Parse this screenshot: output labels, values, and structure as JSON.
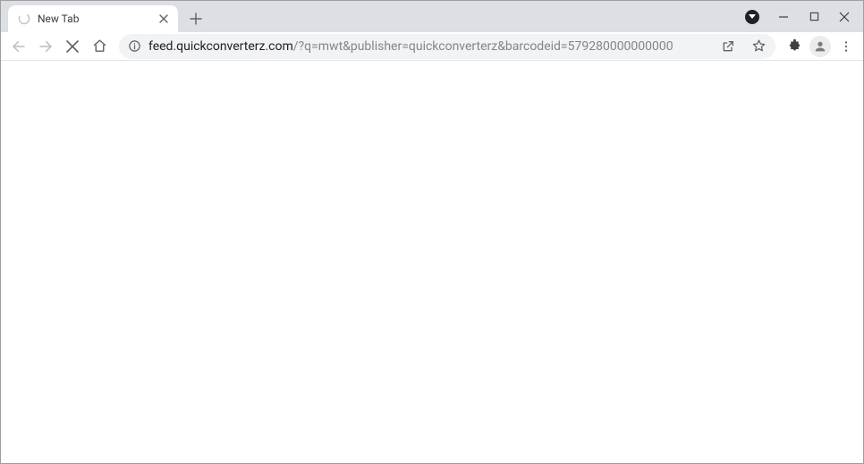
{
  "tabs": [
    {
      "title": "New Tab"
    }
  ],
  "omnibox": {
    "host": "feed.quickconverterz.com",
    "path": "/?q=mwt&publisher=quickconverterz&barcodeid=579280000000000"
  }
}
